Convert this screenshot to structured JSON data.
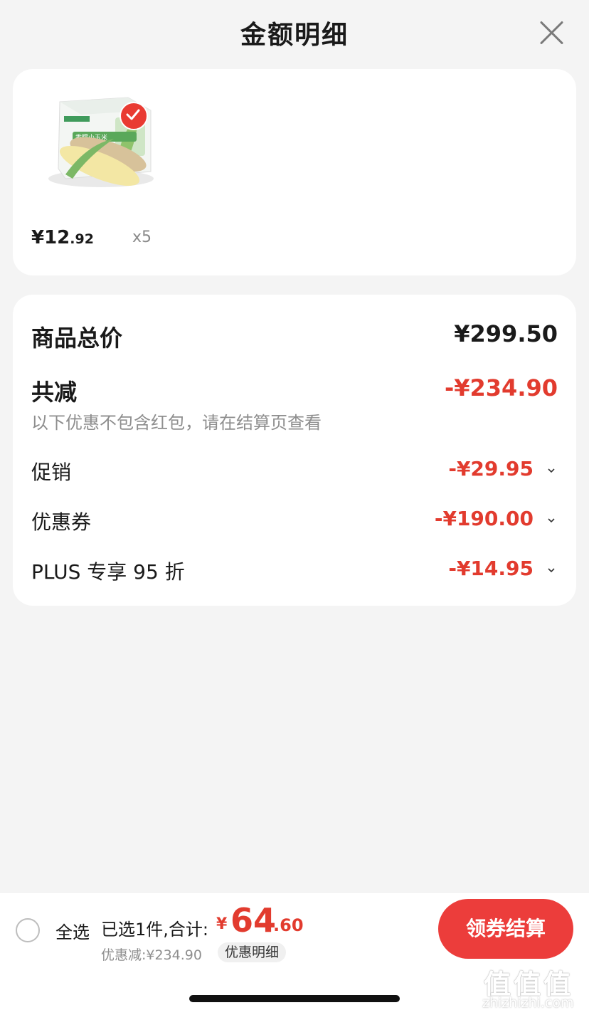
{
  "header": {
    "title": "金额明细"
  },
  "product": {
    "price_prefix": "¥12",
    "price_cents": ".92",
    "quantity": "x5",
    "image_label": "香糯小玉米"
  },
  "summary": {
    "total_label": "商品总价",
    "total_value": "¥299.50",
    "reduce_label": "共减",
    "reduce_value": "-¥234.90",
    "note": "以下优惠不包含红包，请在结算页查看",
    "items": [
      {
        "label": "促销",
        "value": "-¥29.95"
      },
      {
        "label": "优惠券",
        "value": "-¥190.00"
      },
      {
        "label": "PLUS 专享 95 折",
        "value": "-¥14.95"
      }
    ]
  },
  "footer": {
    "select_all": "全选",
    "selected_text": "已选1件,合计:",
    "total_symbol": "¥",
    "total_int": "64",
    "total_dec": ".60",
    "discount_text": "优惠减:¥234.90",
    "detail_label": "优惠明细",
    "checkout_label": "领券结算"
  },
  "watermark": {
    "logo": "值值值",
    "url": "zhizhizhi.com"
  },
  "colors": {
    "accent_red": "#e23b2e",
    "button_red": "#ec3d3b",
    "background": "#f4f4f4"
  }
}
